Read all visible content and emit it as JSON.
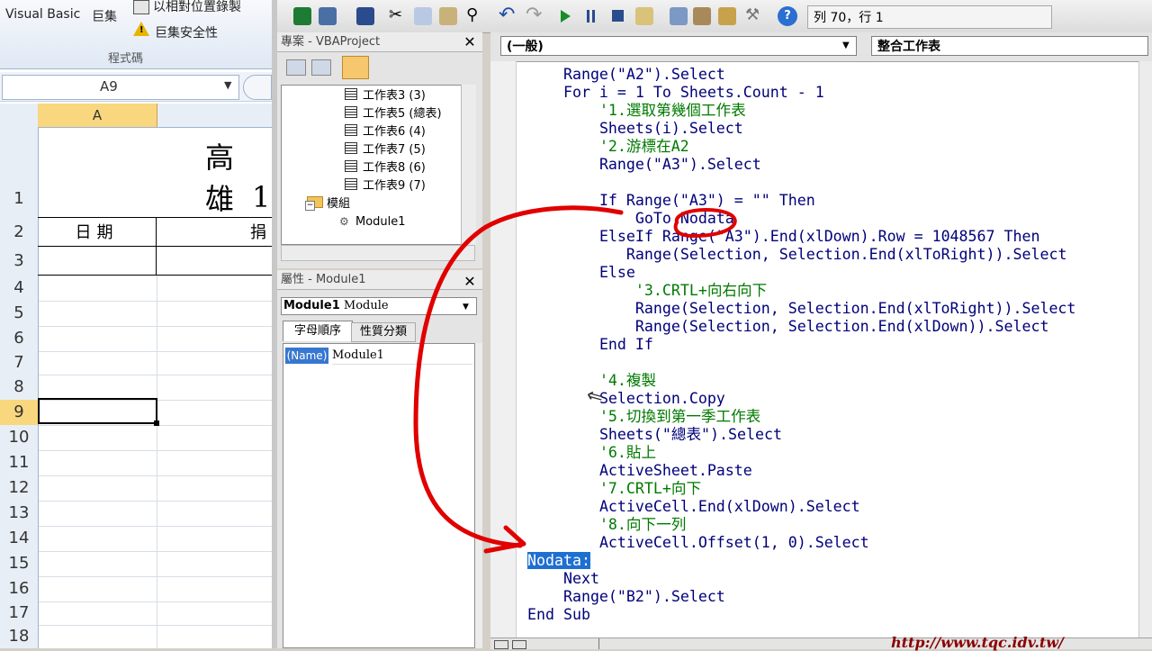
{
  "excel": {
    "ribbon": {
      "visual_basic_label": "Visual Basic",
      "macros_label": "巨集",
      "relative_ref_label": "以相對位置錄製",
      "macro_security_label": "巨集安全性",
      "group_label": "程式碼"
    },
    "name_box_value": "A9",
    "column_header": "A",
    "title_cell_text": "高雄",
    "title_cell_sub": "1",
    "header_cells": [
      "日期",
      "捐"
    ],
    "row_numbers": [
      "1",
      "2",
      "3",
      "4",
      "5",
      "6",
      "7",
      "8",
      "9",
      "10",
      "11",
      "12",
      "13",
      "14",
      "15",
      "16",
      "17",
      "18"
    ],
    "selected_row": "9"
  },
  "vbe": {
    "position_indicator": "列 70，行 1",
    "project_panel": {
      "title": "專案 - VBAProject",
      "tree_items": [
        {
          "label": "工作表3 (3)",
          "type": "sheet"
        },
        {
          "label": "工作表5 (總表)",
          "type": "sheet"
        },
        {
          "label": "工作表6 (4)",
          "type": "sheet"
        },
        {
          "label": "工作表7 (5)",
          "type": "sheet"
        },
        {
          "label": "工作表8 (6)",
          "type": "sheet"
        },
        {
          "label": "工作表9 (7)",
          "type": "sheet"
        },
        {
          "label": "模組",
          "type": "folder"
        },
        {
          "label": "Module1",
          "type": "module"
        }
      ]
    },
    "properties_panel": {
      "title": "屬性 - Module1",
      "object_select": "Module1",
      "object_type": "Module",
      "tab_alphabetic": "字母順序",
      "tab_categorized": "性質分類",
      "prop_name": "(Name)",
      "prop_value": "Module1"
    },
    "code_window": {
      "object_combo": "(一般)",
      "proc_combo": "整合工作表",
      "lines": [
        {
          "indent": "    ",
          "text": "Range(\"A2\").Select",
          "kind": "code"
        },
        {
          "indent": "    ",
          "text": "For i = 1 To Sheets.Count - 1",
          "kind": "code"
        },
        {
          "indent": "        ",
          "text": "'1.選取第幾個工作表",
          "kind": "comment"
        },
        {
          "indent": "        ",
          "text": "Sheets(i).Select",
          "kind": "code"
        },
        {
          "indent": "        ",
          "text": "'2.游標在A2",
          "kind": "comment"
        },
        {
          "indent": "        ",
          "text": "Range(\"A3\").Select",
          "kind": "code"
        },
        {
          "indent": "",
          "text": "",
          "kind": "code"
        },
        {
          "indent": "        ",
          "text": "If Range(\"A3\") = \"\" Then",
          "kind": "code"
        },
        {
          "indent": "            ",
          "text": "GoTo Nodata",
          "kind": "code"
        },
        {
          "indent": "        ",
          "text": "ElseIf Range(\"A3\").End(xlDown).Row = 1048567 Then",
          "kind": "code"
        },
        {
          "indent": "           ",
          "text": "Range(Selection, Selection.End(xlToRight)).Select",
          "kind": "code"
        },
        {
          "indent": "        ",
          "text": "Else",
          "kind": "code"
        },
        {
          "indent": "            ",
          "text": "'3.CRTL+向右向下",
          "kind": "comment"
        },
        {
          "indent": "            ",
          "text": "Range(Selection, Selection.End(xlToRight)).Select",
          "kind": "code"
        },
        {
          "indent": "            ",
          "text": "Range(Selection, Selection.End(xlDown)).Select",
          "kind": "code"
        },
        {
          "indent": "        ",
          "text": "End If",
          "kind": "code"
        },
        {
          "indent": "",
          "text": "",
          "kind": "code"
        },
        {
          "indent": "        ",
          "text": "'4.複製",
          "kind": "comment"
        },
        {
          "indent": "        ",
          "text": "Selection.Copy",
          "kind": "code"
        },
        {
          "indent": "        ",
          "text": "'5.切換到第一季工作表",
          "kind": "comment"
        },
        {
          "indent": "        ",
          "text": "Sheets(\"總表\").Select",
          "kind": "code"
        },
        {
          "indent": "        ",
          "text": "'6.貼上",
          "kind": "comment"
        },
        {
          "indent": "        ",
          "text": "ActiveSheet.Paste",
          "kind": "code"
        },
        {
          "indent": "        ",
          "text": "'7.CRTL+向下",
          "kind": "comment"
        },
        {
          "indent": "        ",
          "text": "ActiveCell.End(xlDown).Select",
          "kind": "code"
        },
        {
          "indent": "        ",
          "text": "'8.向下一列",
          "kind": "comment"
        },
        {
          "indent": "        ",
          "text": "ActiveCell.Offset(1, 0).Select",
          "kind": "code"
        },
        {
          "indent": "",
          "text": "Nodata:",
          "kind": "label"
        },
        {
          "indent": "    ",
          "text": "Next",
          "kind": "code"
        },
        {
          "indent": "    ",
          "text": "Range(\"B2\").Select",
          "kind": "code"
        },
        {
          "indent": "",
          "text": "End Sub",
          "kind": "code"
        }
      ]
    }
  },
  "watermark": "http://www.tqc.idv.tw/",
  "colors": {
    "comment": "#007a00",
    "keyword": "#00007a",
    "selection": "#1f6fd1",
    "annotation": "#e00000"
  }
}
